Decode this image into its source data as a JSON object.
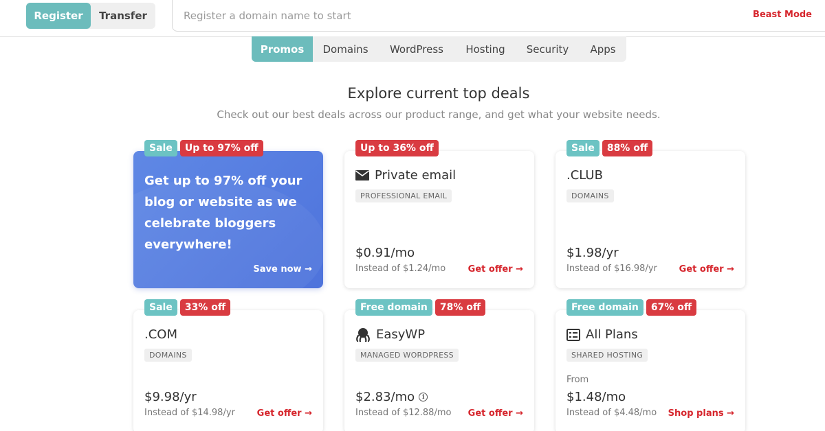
{
  "topbar": {
    "register_label": "Register",
    "transfer_label": "Transfer",
    "search_placeholder": "Register a domain name to start",
    "beast_mode_label": "Beast Mode"
  },
  "categories": [
    "Promos",
    "Domains",
    "WordPress",
    "Hosting",
    "Security",
    "Apps"
  ],
  "heading": {
    "title": "Explore current top deals",
    "subtitle": "Check out our best deals across our product range, and get what your website needs."
  },
  "colors": {
    "accent_teal": "#6cbcbc",
    "sale_red": "#d93b41",
    "link_red": "#d6262d",
    "promo_blue": "#5a82e3"
  },
  "cards": [
    {
      "badges": [
        "Sale",
        "Up to 97% off"
      ],
      "text": "Get up to 97% off your blog or website as we celebrate bloggers everywhere!",
      "link": "Save now →"
    },
    {
      "badges": [
        "Up to 36% off"
      ],
      "icon": "envelope-icon",
      "title": "Private email",
      "tag": "PROFESSIONAL EMAIL",
      "price": "$0.91/mo",
      "instead": "Instead of $1.24/mo",
      "link": "Get offer →"
    },
    {
      "badges": [
        "Sale",
        "88% off"
      ],
      "title": ".CLUB",
      "tag": "DOMAINS",
      "price": "$1.98/yr",
      "instead": "Instead of $16.98/yr",
      "link": "Get offer →"
    },
    {
      "badges": [
        "Sale",
        "33% off"
      ],
      "title": ".COM",
      "tag": "DOMAINS",
      "price": "$9.98/yr",
      "instead": "Instead of $14.98/yr",
      "link": "Get offer →"
    },
    {
      "badges": [
        "Free domain",
        "78% off"
      ],
      "icon": "octopus-icon",
      "title": "EasyWP",
      "tag": "MANAGED WORDPRESS",
      "price": "$2.83/mo",
      "info_icon": "info-icon",
      "instead": "Instead of $12.88/mo",
      "link": "Get offer →"
    },
    {
      "badges": [
        "Free domain",
        "67% off"
      ],
      "icon": "server-list-icon",
      "title": "All Plans",
      "tag": "SHARED HOSTING",
      "from": "From",
      "price": "$1.48/mo",
      "instead": "Instead of $4.48/mo",
      "link": "Shop plans →"
    }
  ]
}
